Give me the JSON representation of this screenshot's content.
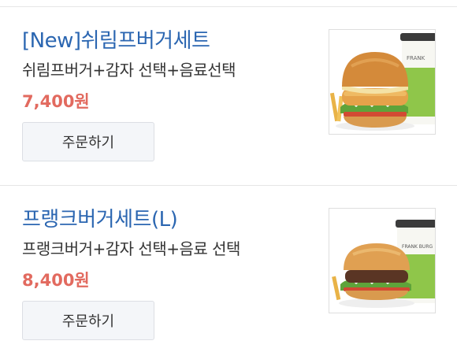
{
  "items": [
    {
      "title": "[New]쉬림프버거세트",
      "description": "쉬림프버거+감자 선택+음료선택",
      "price": "7,400원",
      "order_label": "주문하기",
      "image_label": "FRANK"
    },
    {
      "title": "프랭크버거세트(L)",
      "description": "프랭크버거+감자 선택+음료 선택",
      "price": "8,400원",
      "order_label": "주문하기",
      "image_label": "FRANK BURG"
    }
  ],
  "colors": {
    "title": "#2b66b1",
    "price": "#e26a5f",
    "button_bg": "#f4f6f9"
  }
}
